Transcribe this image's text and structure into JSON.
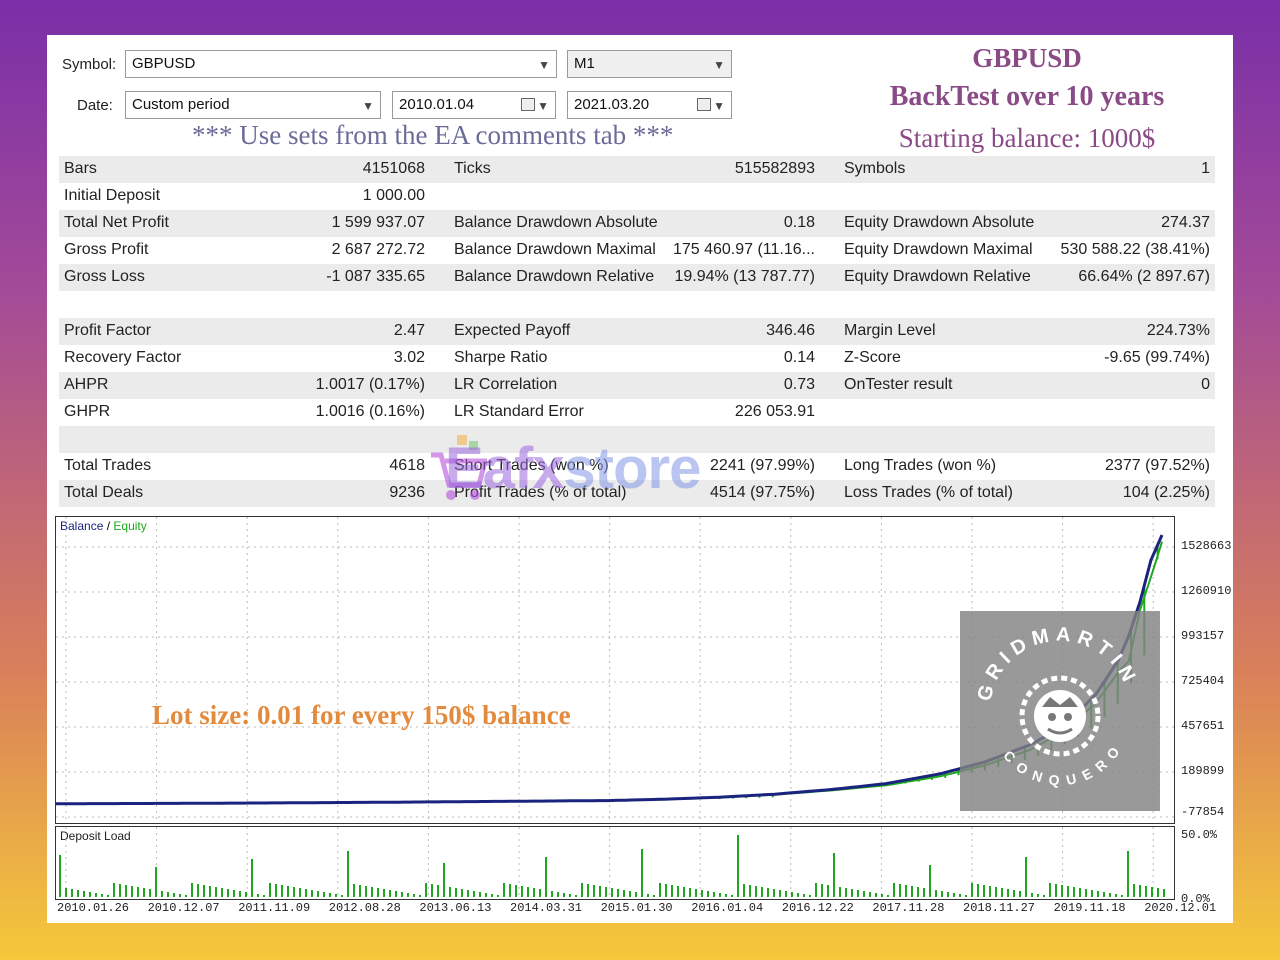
{
  "controls": {
    "symbol_label": "Symbol:",
    "symbol_value": "GBPUSD",
    "period_value": "M1",
    "date_label": "Date:",
    "date_mode": "Custom period",
    "date_from": "2010.01.04",
    "date_to": "2021.03.20"
  },
  "notice": "*** Use sets from the EA comments tab ***",
  "promo": {
    "line1": "GBPUSD",
    "line2": "BackTest over 10 years",
    "line3": "Starting balance: 1000$"
  },
  "stats": {
    "rows": [
      {
        "shade": true,
        "l1": "Bars",
        "v1": "4151068",
        "l2": "Ticks",
        "v2": "515582893",
        "l3": "Symbols",
        "v3": "1"
      },
      {
        "shade": false,
        "l1": "Initial Deposit",
        "v1": "1 000.00",
        "l2": "",
        "v2": "",
        "l3": "",
        "v3": ""
      },
      {
        "shade": true,
        "l1": "Total Net Profit",
        "v1": "1 599 937.07",
        "l2": "Balance Drawdown Absolute",
        "v2": "0.18",
        "l3": "Equity Drawdown Absolute",
        "v3": "274.37"
      },
      {
        "shade": false,
        "l1": "Gross Profit",
        "v1": "2 687 272.72",
        "l2": "Balance Drawdown Maximal",
        "v2": "175 460.97 (11.16...",
        "l3": "Equity Drawdown Maximal",
        "v3": "530 588.22 (38.41%)"
      },
      {
        "shade": true,
        "l1": "Gross Loss",
        "v1": "-1 087 335.65",
        "l2": "Balance Drawdown Relative",
        "v2": "19.94% (13 787.77)",
        "l3": "Equity Drawdown Relative",
        "v3": "66.64% (2 897.67)"
      },
      {
        "shade": false,
        "l1": "",
        "v1": "",
        "l2": "",
        "v2": "",
        "l3": "",
        "v3": ""
      },
      {
        "shade": true,
        "l1": "Profit Factor",
        "v1": "2.47",
        "l2": "Expected Payoff",
        "v2": "346.46",
        "l3": "Margin Level",
        "v3": "224.73%"
      },
      {
        "shade": false,
        "l1": "Recovery Factor",
        "v1": "3.02",
        "l2": "Sharpe Ratio",
        "v2": "0.14",
        "l3": "Z-Score",
        "v3": "-9.65 (99.74%)"
      },
      {
        "shade": true,
        "l1": "AHPR",
        "v1": "1.0017 (0.17%)",
        "l2": "LR Correlation",
        "v2": "0.73",
        "l3": "OnTester result",
        "v3": "0"
      },
      {
        "shade": false,
        "l1": "GHPR",
        "v1": "1.0016 (0.16%)",
        "l2": "LR Standard Error",
        "v2": "226 053.91",
        "l3": "",
        "v3": ""
      },
      {
        "shade": true,
        "l1": "",
        "v1": "",
        "l2": "",
        "v2": "",
        "l3": "",
        "v3": ""
      },
      {
        "shade": false,
        "l1": "Total Trades",
        "v1": "4618",
        "l2": "Short Trades (won %)",
        "v2": "2241 (97.99%)",
        "l3": "Long Trades (won %)",
        "v3": "2377 (97.52%)"
      },
      {
        "shade": true,
        "l1": "Total Deals",
        "v1": "9236",
        "l2": "Profit Trades (% of total)",
        "v2": "4514 (97.75%)",
        "l3": "Loss Trades (% of total)",
        "v3": "104 (2.25%)"
      }
    ]
  },
  "chart": {
    "legend_balance": "Balance",
    "legend_sep": " / ",
    "legend_equity": "Equity",
    "balance_color": "#1a237e",
    "equity_color": "#1fa81f",
    "y_ticks": [
      "1528663",
      "1260910",
      "993157",
      "725404",
      "457651",
      "189899",
      "-77854"
    ],
    "x_ticks": [
      "2010.01.26",
      "2010.12.07",
      "2011.11.09",
      "2012.08.28",
      "2013.06.13",
      "2014.03.31",
      "2015.01.30",
      "2016.01.04",
      "2016.12.22",
      "2017.11.28",
      "2018.11.27",
      "2019.11.18",
      "2020.12.01"
    ],
    "overlay": "Lot size: 0.01 for every 150$ balance"
  },
  "deposit_load": {
    "label": "Deposit Load",
    "y_top": "50.0%",
    "y_bottom": "0.0%"
  },
  "watermark": {
    "part1": "Eafx",
    "part2": "store"
  },
  "emblem": {
    "text": "GRIDMARTIN",
    "text2": "CONQUEROR"
  },
  "chart_data": {
    "type": "line",
    "series": [
      {
        "name": "Balance",
        "x": [
          0,
          10,
          20,
          30,
          40,
          50,
          55,
          60,
          65,
          70,
          75,
          80,
          84,
          88,
          90,
          92,
          94,
          96,
          97,
          98,
          99,
          100
        ],
        "y": [
          1000,
          3000,
          6000,
          10000,
          15000,
          20000,
          28000,
          40000,
          58000,
          85000,
          120000,
          180000,
          250000,
          350000,
          420000,
          520000,
          650000,
          850000,
          1000000,
          1200000,
          1450000,
          1600000
        ]
      },
      {
        "name": "Equity",
        "x": [
          0,
          10,
          20,
          30,
          40,
          50,
          55,
          60,
          65,
          70,
          75,
          80,
          84,
          88,
          90,
          92,
          94,
          96,
          97,
          98,
          99,
          100
        ],
        "y": [
          1000,
          2800,
          5800,
          9500,
          14500,
          19000,
          26000,
          38000,
          55000,
          80000,
          110000,
          165000,
          230000,
          320000,
          390000,
          480000,
          600000,
          780000,
          850000,
          1150000,
          1350000,
          1560000
        ]
      }
    ],
    "ylim": [
      -77854,
      1528663
    ]
  }
}
